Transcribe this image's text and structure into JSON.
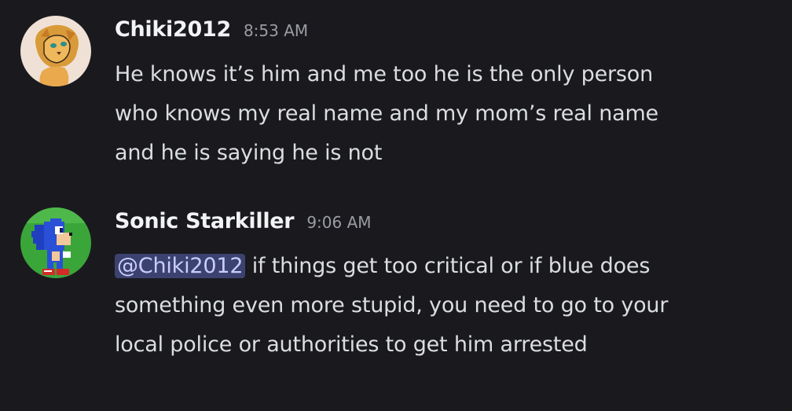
{
  "messages": [
    {
      "author": "Chiki2012",
      "timestamp": "8:53 AM",
      "avatar_icon": "lion-cub-avatar",
      "lines": [
        "He knows it’s him and me too he is the only person",
        "who knows my real name and my mom’s real name",
        "and he is saying he is not"
      ]
    },
    {
      "author": "Sonic Starkiller",
      "timestamp": "9:06 AM",
      "avatar_icon": "sonic-sprite-avatar",
      "mention": "@Chiki2012",
      "line1_rest": " if things get too critical or if blue does",
      "lines_rest": [
        "something even more stupid, you need to go to your",
        "local police or authorities to get him arrested"
      ]
    }
  ],
  "colors": {
    "background": "#1a1a1e",
    "username": "#f2f3f5",
    "timestamp": "#9a9ca3",
    "text": "#dbdee1",
    "mention_bg": "#3c4270",
    "mention_text": "#c9cdfb"
  }
}
